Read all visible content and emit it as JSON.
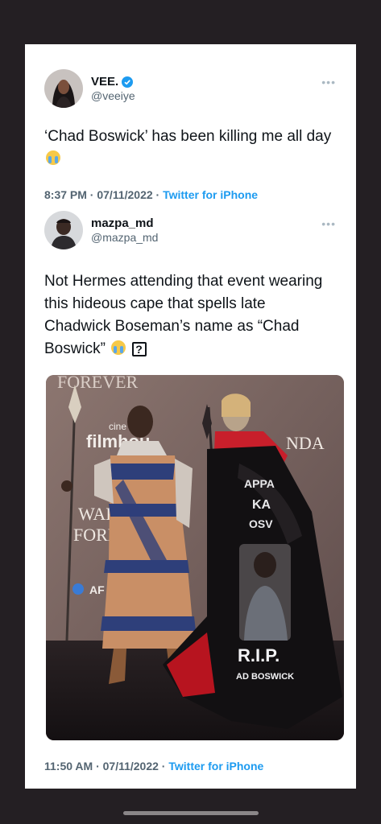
{
  "colors": {
    "accent": "#1d9bf0",
    "verified": "#1d9bf0",
    "background": "#241f23",
    "card": "#ffffff"
  },
  "quote_tweet": {
    "display_name": "VEE.",
    "handle": "@veeiye",
    "verified": true,
    "text": "‘Chad Boswick’ has been killing me all day",
    "emoji": "crying-laughing-emoji",
    "time": "8:37 PM · 07/11/2022 ·",
    "source": "Twitter for iPhone",
    "more_icon": "more-icon"
  },
  "original_tweet": {
    "display_name": "mazpa_md",
    "handle": "@mazpa_md",
    "text": "Not Hermes attending that event wearing this hideous cape that spells late Chadwick Boseman’s name as “Chad Boswick”",
    "emoji": "crying-laughing-emoji",
    "unknown_glyph": "?",
    "time": "11:50 AM · 07/11/2022 ·",
    "source": "Twitter for iPhone",
    "more_icon": "more-icon"
  },
  "photo": {
    "backdrop_words": [
      "FOREVER",
      "cine",
      "filmhou",
      "WAKA",
      "FORE",
      "NDA",
      "AF"
    ],
    "cape_words": [
      "APPA",
      "KA",
      "OSV",
      "R.I.P.",
      "AD BOSWICK"
    ]
  }
}
